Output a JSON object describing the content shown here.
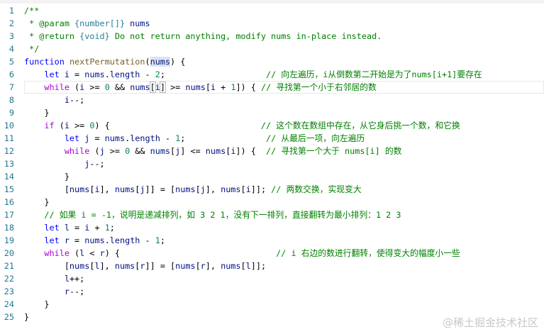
{
  "current_line": 7,
  "lines": [
    [
      [
        "cm",
        "/**"
      ]
    ],
    [
      [
        "cm",
        " * @param "
      ],
      [
        "ty",
        "{number[]}"
      ],
      [
        "var",
        " nums"
      ]
    ],
    [
      [
        "cm",
        " * @return "
      ],
      [
        "ty",
        "{void}"
      ],
      [
        "cm",
        " Do not return anything, modify nums in-place instead."
      ]
    ],
    [
      [
        "cm",
        " */"
      ]
    ],
    [
      [
        "kw",
        "function"
      ],
      [
        "p",
        " "
      ],
      [
        "fn",
        "nextPermutation"
      ],
      [
        "p",
        "("
      ],
      [
        "var hl",
        "nums"
      ],
      [
        "p",
        ") {"
      ]
    ],
    [
      [
        "p",
        "    "
      ],
      [
        "kw",
        "let"
      ],
      [
        "p",
        " "
      ],
      [
        "var",
        "i"
      ],
      [
        "p",
        " = "
      ],
      [
        "var",
        "nums"
      ],
      [
        "p",
        "."
      ],
      [
        "var",
        "length"
      ],
      [
        "p",
        " - "
      ],
      [
        "num",
        "2"
      ],
      [
        "p",
        ";                    "
      ],
      [
        "cm",
        "// 向左遍历，i从倒数第二开始是为了nums[i+1]要存在"
      ]
    ],
    [
      [
        "p",
        "    "
      ],
      [
        "ctl",
        "while"
      ],
      [
        "p",
        " ("
      ],
      [
        "var",
        "i"
      ],
      [
        "p",
        " >= "
      ],
      [
        "num",
        "0"
      ],
      [
        "p",
        " && "
      ],
      [
        "var",
        "nums"
      ],
      [
        "p br",
        "["
      ],
      [
        "var",
        "i"
      ],
      [
        "p br",
        "]"
      ],
      [
        "p",
        " >= "
      ],
      [
        "var",
        "nums"
      ],
      [
        "p",
        "["
      ],
      [
        "var",
        "i"
      ],
      [
        "p",
        " + "
      ],
      [
        "num",
        "1"
      ],
      [
        "p",
        "]) { "
      ],
      [
        "cm",
        "// 寻找第一个小于右邻居的数"
      ]
    ],
    [
      [
        "p",
        "        "
      ],
      [
        "var",
        "i"
      ],
      [
        "p",
        "--;"
      ]
    ],
    [
      [
        "p",
        "    }"
      ]
    ],
    [
      [
        "p",
        "    "
      ],
      [
        "ctl",
        "if"
      ],
      [
        "p",
        " ("
      ],
      [
        "var",
        "i"
      ],
      [
        "p",
        " >= "
      ],
      [
        "num",
        "0"
      ],
      [
        "p",
        ") {                              "
      ],
      [
        "cm",
        "// 这个数在数组中存在，从它身后挑一个数，和它换"
      ]
    ],
    [
      [
        "p",
        "        "
      ],
      [
        "kw",
        "let"
      ],
      [
        "p",
        " "
      ],
      [
        "var",
        "j"
      ],
      [
        "p",
        " = "
      ],
      [
        "var",
        "nums"
      ],
      [
        "p",
        "."
      ],
      [
        "var",
        "length"
      ],
      [
        "p",
        " - "
      ],
      [
        "num",
        "1"
      ],
      [
        "p",
        ";                "
      ],
      [
        "cm",
        "// 从最后一项，向左遍历"
      ]
    ],
    [
      [
        "p",
        "        "
      ],
      [
        "ctl",
        "while"
      ],
      [
        "p",
        " ("
      ],
      [
        "var",
        "j"
      ],
      [
        "p",
        " >= "
      ],
      [
        "num",
        "0"
      ],
      [
        "p",
        " && "
      ],
      [
        "var",
        "nums"
      ],
      [
        "p",
        "["
      ],
      [
        "var",
        "j"
      ],
      [
        "p",
        "] <= "
      ],
      [
        "var",
        "nums"
      ],
      [
        "p",
        "["
      ],
      [
        "var",
        "i"
      ],
      [
        "p",
        "]) {  "
      ],
      [
        "cm",
        "// 寻找第一个大于 nums[i] 的数"
      ]
    ],
    [
      [
        "p",
        "            "
      ],
      [
        "var",
        "j"
      ],
      [
        "p",
        "--;"
      ]
    ],
    [
      [
        "p",
        "        }"
      ]
    ],
    [
      [
        "p",
        "        ["
      ],
      [
        "var",
        "nums"
      ],
      [
        "p",
        "["
      ],
      [
        "var",
        "i"
      ],
      [
        "p",
        "], "
      ],
      [
        "var",
        "nums"
      ],
      [
        "p",
        "["
      ],
      [
        "var",
        "j"
      ],
      [
        "p",
        "]] = ["
      ],
      [
        "var",
        "nums"
      ],
      [
        "p",
        "["
      ],
      [
        "var",
        "j"
      ],
      [
        "p",
        "], "
      ],
      [
        "var",
        "nums"
      ],
      [
        "p",
        "["
      ],
      [
        "var",
        "i"
      ],
      [
        "p",
        "]]; "
      ],
      [
        "cm",
        "// 两数交换，实现变大"
      ]
    ],
    [
      [
        "p",
        "    }"
      ]
    ],
    [
      [
        "p",
        "    "
      ],
      [
        "cm",
        "// 如果 i = -1，说明是递减排列，如 3 2 1，没有下一排列，直接翻转为最小排列：1 2 3"
      ]
    ],
    [
      [
        "p",
        "    "
      ],
      [
        "kw",
        "let"
      ],
      [
        "p",
        " "
      ],
      [
        "var",
        "l"
      ],
      [
        "p",
        " = "
      ],
      [
        "var",
        "i"
      ],
      [
        "p",
        " + "
      ],
      [
        "num",
        "1"
      ],
      [
        "p",
        ";"
      ]
    ],
    [
      [
        "p",
        "    "
      ],
      [
        "kw",
        "let"
      ],
      [
        "p",
        " "
      ],
      [
        "var",
        "r"
      ],
      [
        "p",
        " = "
      ],
      [
        "var",
        "nums"
      ],
      [
        "p",
        "."
      ],
      [
        "var",
        "length"
      ],
      [
        "p",
        " - "
      ],
      [
        "num",
        "1"
      ],
      [
        "p",
        ";"
      ]
    ],
    [
      [
        "p",
        "    "
      ],
      [
        "ctl",
        "while"
      ],
      [
        "p",
        " ("
      ],
      [
        "var",
        "l"
      ],
      [
        "p",
        " < "
      ],
      [
        "var",
        "r"
      ],
      [
        "p",
        ") {                               "
      ],
      [
        "cm",
        "// i 右边的数进行翻转，使得变大的幅度小一些"
      ]
    ],
    [
      [
        "p",
        "        ["
      ],
      [
        "var",
        "nums"
      ],
      [
        "p",
        "["
      ],
      [
        "var",
        "l"
      ],
      [
        "p",
        "], "
      ],
      [
        "var",
        "nums"
      ],
      [
        "p",
        "["
      ],
      [
        "var",
        "r"
      ],
      [
        "p",
        "]] = ["
      ],
      [
        "var",
        "nums"
      ],
      [
        "p",
        "["
      ],
      [
        "var",
        "r"
      ],
      [
        "p",
        "], "
      ],
      [
        "var",
        "nums"
      ],
      [
        "p",
        "["
      ],
      [
        "var",
        "l"
      ],
      [
        "p",
        "]];"
      ]
    ],
    [
      [
        "p",
        "        "
      ],
      [
        "var",
        "l"
      ],
      [
        "p",
        "++;"
      ]
    ],
    [
      [
        "p",
        "        "
      ],
      [
        "var",
        "r"
      ],
      [
        "p",
        "--;"
      ]
    ],
    [
      [
        "p",
        "    }"
      ]
    ],
    [
      [
        "p",
        "}"
      ]
    ]
  ],
  "watermark": "@稀土掘金技术社区"
}
